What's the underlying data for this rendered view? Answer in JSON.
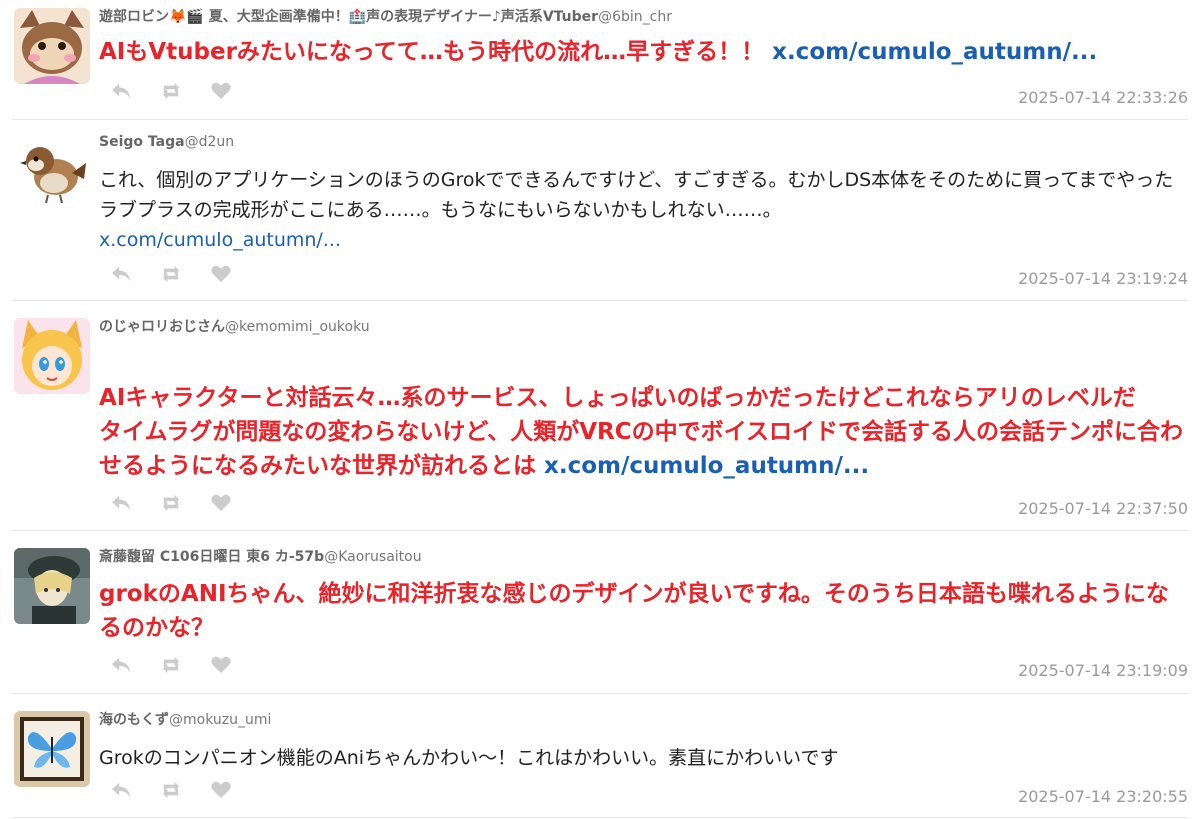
{
  "tweets": [
    {
      "author_name": "遊部ロビン🦊🎬 夏、大型企画準備中！🏥声の表現デザイナー♪声活系VTuber",
      "handle": "@6bin_chr",
      "text": "AIもVtuberみたいになってて…もう時代の流れ…早すぎる！！ ",
      "link": "x.com/cumulo_autumn/...",
      "timestamp": "2025-07-14 22:33:26",
      "style": "highlight",
      "avatar_icon": "orange-fox-avatar-icon"
    },
    {
      "author_name": "Seigo Taga",
      "handle": "@d2un",
      "text": "これ、個別のアプリケーションのほうのGrokでできるんですけど、すごすぎる。むかしDS本体をそのために買ってまでやったラブプラスの完成形がここにある……。もうなにもいらないかもしれない……。",
      "link": "x.com/cumulo_autumn/...",
      "timestamp": "2025-07-14 23:19:24",
      "style": "normal",
      "avatar_icon": "sparrow-avatar-icon"
    },
    {
      "author_name": "のじゃロリおじさん",
      "handle": "@kemomimi_oukoku",
      "text": "AIキャラクターと対話云々…系のサービス、しょっぱいのばっかだったけどこれならアリのレベルだ\nタイムラグが問題なの変わらないけど、人類がVRCの中でボイスロイドで会話する人の会話テンポに合わせるようになるみたいな世界が訪れるとは ",
      "link": "x.com/cumulo_autumn/...",
      "timestamp": "2025-07-14 22:37:50",
      "style": "highlight",
      "avatar_icon": "fox-girl-avatar-icon"
    },
    {
      "author_name": "斎藤馥留 C106日曜日 東6 カ-57b",
      "handle": "@Kaorusaitou",
      "text": "grokのANIちゃん、絶妙に和洋折衷な感じのデザインが良いですね。そのうち日本語も喋れるようになるのかな？",
      "link": "",
      "timestamp": "2025-07-14 23:19:09",
      "style": "highlight",
      "avatar_icon": "uniform-character-avatar-icon"
    },
    {
      "author_name": "海のもくず",
      "handle": "@mokuzu_umi",
      "text": "Grokのコンパニオン機能のAniちゃんかわい〜！これはかわいい。素直にかわいいです",
      "link": "",
      "timestamp": "2025-07-14 23:20:55",
      "style": "normal",
      "avatar_icon": "butterfly-frame-avatar-icon"
    }
  ],
  "action_icons": [
    "reply-icon",
    "retweet-icon",
    "like-icon"
  ],
  "colors": {
    "highlight_text": "#e8232a",
    "link": "#1a5fb4",
    "meta_gray": "#9a9a9a"
  }
}
